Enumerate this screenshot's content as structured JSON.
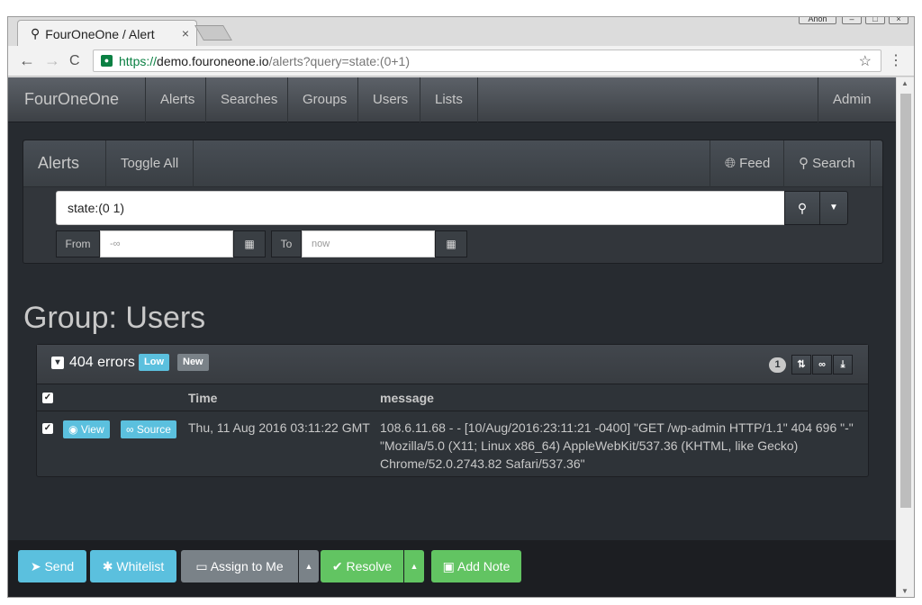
{
  "browser": {
    "tab_title": "FourOneOne / Alert",
    "tab_close": "×",
    "url_scheme": "https://",
    "url_host": "demo.fouroneone.io",
    "url_path": "/alerts?query=state:(0+1)",
    "window_user": "Anon",
    "back": "←",
    "forward": "→",
    "reload": "C",
    "star": "☆",
    "menu": "⋮"
  },
  "navbar": {
    "brand": "FourOneOne",
    "items": [
      "Alerts",
      "Searches",
      "Groups",
      "Users",
      "Lists"
    ],
    "admin": "Admin ▾"
  },
  "alerts_panel": {
    "title": "Alerts",
    "toggle_all": "Toggle All",
    "feed": "Feed",
    "search": "Search",
    "query_value": "state:(0 1)",
    "from_label": "From",
    "from_value": "-∞",
    "to_label": "To",
    "to_value": "now"
  },
  "group": {
    "title": "Group: Users",
    "alert": {
      "title": "404 errors",
      "label_low": "Low",
      "label_new": "New",
      "count": "1",
      "columns": {
        "time": "Time",
        "message": "message"
      },
      "rows": [
        {
          "view": "View",
          "source": "Source",
          "time": "Thu, 11 Aug 2016 03:11:22 GMT",
          "message_line1": "108.6.11.68 - - [10/Aug/2016:23:11:21 -0400] \"GET /wp-admin HTTP/1.1\" 404 696 \"-\"",
          "message_line2": "\"Mozilla/5.0 (X11; Linux x86_64) AppleWebKit/537.36 (KHTML, like Gecko)",
          "message_line3": "Chrome/52.0.2743.82 Safari/537.36\""
        }
      ]
    }
  },
  "actions": {
    "send": "Send",
    "whitelist": "Whitelist",
    "assign": "Assign to Me",
    "resolve": "Resolve",
    "add_note": "Add Note"
  },
  "colors": {
    "info": "#5bc0de",
    "success": "#62c462",
    "default": "#7a8288",
    "page_bg": "#272b30"
  }
}
